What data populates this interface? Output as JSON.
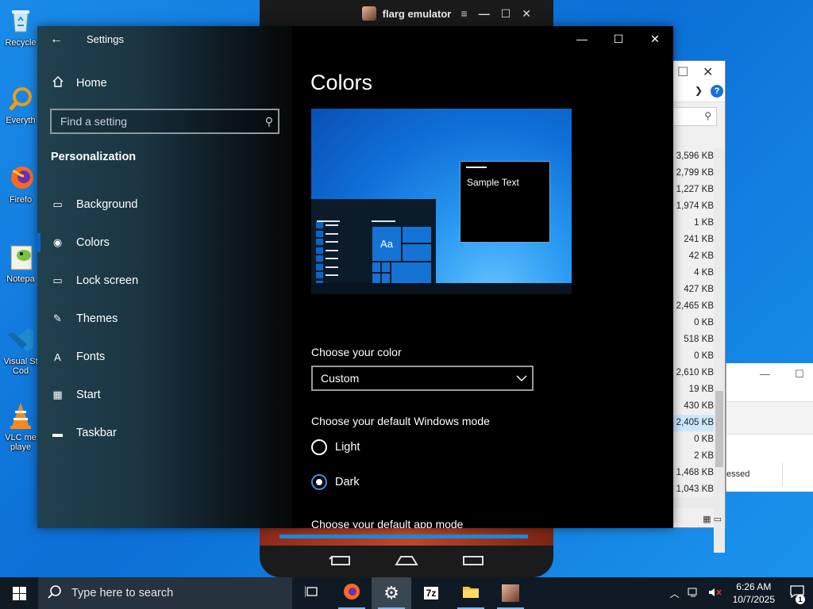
{
  "desktop": {
    "icons": [
      {
        "label": "Recycle",
        "icon": "recycle-bin-icon"
      },
      {
        "label": "Everyth",
        "icon": "everything-search-icon"
      },
      {
        "label": "Firefo",
        "icon": "firefox-icon"
      },
      {
        "label": "Notepa",
        "icon": "notepad-plus-icon"
      },
      {
        "label": "Visual St",
        "label2": "Cod",
        "icon": "vscode-icon"
      },
      {
        "label": "VLC me",
        "label2": "playe",
        "icon": "vlc-icon"
      }
    ]
  },
  "emulator": {
    "title": "flarg emulator",
    "controls": [
      "≡",
      "—",
      "☐",
      "✕"
    ]
  },
  "explorer": {
    "sizes": [
      "3,596 KB",
      "2,799 KB",
      "1,227 KB",
      "1,974 KB",
      "1 KB",
      "241 KB",
      "42 KB",
      "4 KB",
      "427 KB",
      "2,465 KB",
      "0 KB",
      "518 KB",
      "0 KB",
      "2,610 KB",
      "19 KB",
      "430 KB",
      "2,405 KB",
      "0 KB",
      "2 KB",
      "1,468 KB",
      "1,043 KB"
    ],
    "selected_index": 16
  },
  "win3": {
    "text": "essed"
  },
  "settings": {
    "window_title": "Settings",
    "back_glyph": "←",
    "home_label": "Home",
    "search_placeholder": "Find a setting",
    "section": "Personalization",
    "nav": [
      {
        "label": "Background",
        "icon": "background-icon",
        "glyph": "▭"
      },
      {
        "label": "Colors",
        "icon": "palette-icon",
        "glyph": "◉",
        "active": true
      },
      {
        "label": "Lock screen",
        "icon": "lock-screen-icon",
        "glyph": "▭"
      },
      {
        "label": "Themes",
        "icon": "themes-icon",
        "glyph": "✎"
      },
      {
        "label": "Fonts",
        "icon": "fonts-icon",
        "glyph": "A"
      },
      {
        "label": "Start",
        "icon": "start-icon",
        "glyph": "▦"
      },
      {
        "label": "Taskbar",
        "icon": "taskbar-icon",
        "glyph": "▬"
      }
    ],
    "page_title": "Colors",
    "preview": {
      "tile_text": "Aa",
      "sample_text": "Sample Text"
    },
    "choose_color_label": "Choose your color",
    "choose_color_value": "Custom",
    "windows_mode_label": "Choose your default Windows mode",
    "mode_options": [
      {
        "label": "Light",
        "checked": false
      },
      {
        "label": "Dark",
        "checked": true
      }
    ],
    "app_mode_label": "Choose your default app mode",
    "accent_color": "#0a64c8"
  },
  "taskbar": {
    "search_placeholder": "Type here to search",
    "apps": [
      {
        "name": "task-view",
        "glyph": "⧉"
      },
      {
        "name": "firefox",
        "glyph": "●"
      },
      {
        "name": "settings",
        "glyph": "⚙"
      },
      {
        "name": "7zip",
        "glyph": "7z"
      },
      {
        "name": "file-explorer",
        "glyph": "▬"
      },
      {
        "name": "flarg-emulator",
        "glyph": "■"
      }
    ],
    "time": "6:26 AM",
    "date": "10/7/2025",
    "notification_count": "1"
  }
}
